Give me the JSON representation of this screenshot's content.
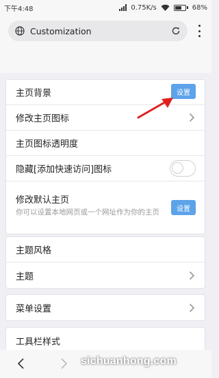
{
  "status_bar": {
    "time": "下午4:48",
    "network_speed": "0.75K/s",
    "battery": "68%",
    "battery_level": 0.68
  },
  "url_bar": {
    "text": "Customization"
  },
  "sections": {
    "homepage": {
      "background_label": "主页背景",
      "background_button": "设置",
      "change_icon_label": "修改主页图标",
      "icon_opacity_label": "主页图标透明度",
      "hide_quick_access_label": "隐藏[添加快速访问]图标",
      "hide_quick_access_on": false,
      "default_home_label": "修改默认主页",
      "default_home_desc": "你可以设置本地网页或一个网址作为你的主页",
      "default_home_button": "设置"
    },
    "theme": {
      "style_label": "主题风格",
      "theme_label": "主题"
    },
    "menu": {
      "menu_settings_label": "菜单设置"
    },
    "toolbar": {
      "style_label": "工具栏样式"
    }
  },
  "watermark": "sichuanhong.com",
  "colors": {
    "accent": "#5da3ea",
    "annotation_arrow": "#e02020"
  }
}
